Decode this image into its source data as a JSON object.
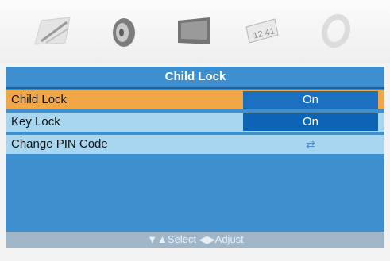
{
  "menu": {
    "tabs": [
      {
        "icon": "picture-icon",
        "active": true
      },
      {
        "icon": "speaker-icon",
        "active": false
      },
      {
        "icon": "screen-icon",
        "active": false
      },
      {
        "icon": "channel-icon",
        "active": false
      },
      {
        "icon": "setup-icon",
        "active": false
      }
    ],
    "channel_icon_text": "12 41",
    "title": "Child Lock",
    "rows": [
      {
        "label": "Child Lock",
        "value": "On",
        "selected": true
      },
      {
        "label": "Key Lock",
        "value": "On",
        "selected": false
      },
      {
        "label": "Change PIN Code",
        "value_icon": "enter-arrow-icon",
        "value_glyph": "⇄",
        "selected": false
      }
    ],
    "footer": "▼▲Select  ◀▶Adjust"
  },
  "colors": {
    "panel": "#3d8fcf",
    "selected_row": "#f0a748",
    "row": "#a8d6ee",
    "value_box": "#0d63b6",
    "footer": "#9fb6c8"
  }
}
